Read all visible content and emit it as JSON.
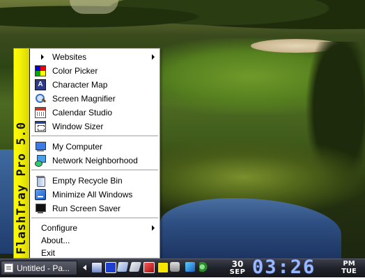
{
  "menu": {
    "sidebar_title": "FlashTray Pro 5.0",
    "items": [
      {
        "label": "Websites",
        "icon": "right-arrow",
        "submenu": true
      },
      {
        "label": "Color Picker",
        "icon": "color-picker-icon"
      },
      {
        "label": "Character Map",
        "icon": "character-map-icon",
        "glyph": "A"
      },
      {
        "label": "Screen Magnifier",
        "icon": "magnifier-icon"
      },
      {
        "label": "Calendar Studio",
        "icon": "calendar-icon"
      },
      {
        "label": "Window Sizer",
        "icon": "window-sizer-icon"
      },
      {
        "label": "My Computer",
        "icon": "computer-icon"
      },
      {
        "label": "Network Neighborhood",
        "icon": "network-icon"
      },
      {
        "label": "Empty Recycle Bin",
        "icon": "recycle-bin-icon"
      },
      {
        "label": "Minimize All Windows",
        "icon": "minimize-windows-icon"
      },
      {
        "label": "Run Screen Saver",
        "icon": "screensaver-icon"
      },
      {
        "label": "Configure",
        "submenu": true
      },
      {
        "label": "About..."
      },
      {
        "label": "Exit"
      }
    ]
  },
  "taskbar": {
    "task_button_label": "Untitled - Pa...",
    "tray_icons": [
      "monitor-icon",
      "display-icon",
      "network-icon",
      "stationery-icon",
      "power-icon",
      "flash-icon",
      "drive-icon",
      "sync-icon",
      "volume-icon"
    ],
    "clock": {
      "day": "30",
      "month": "SEP",
      "time": "03:26",
      "ampm": "PM",
      "weekday": "TUE"
    }
  },
  "colors": {
    "sidebar_yellow": "#fffd00",
    "clock_blue": "#9ab8ff",
    "taskbar_dark": "#20222a"
  }
}
